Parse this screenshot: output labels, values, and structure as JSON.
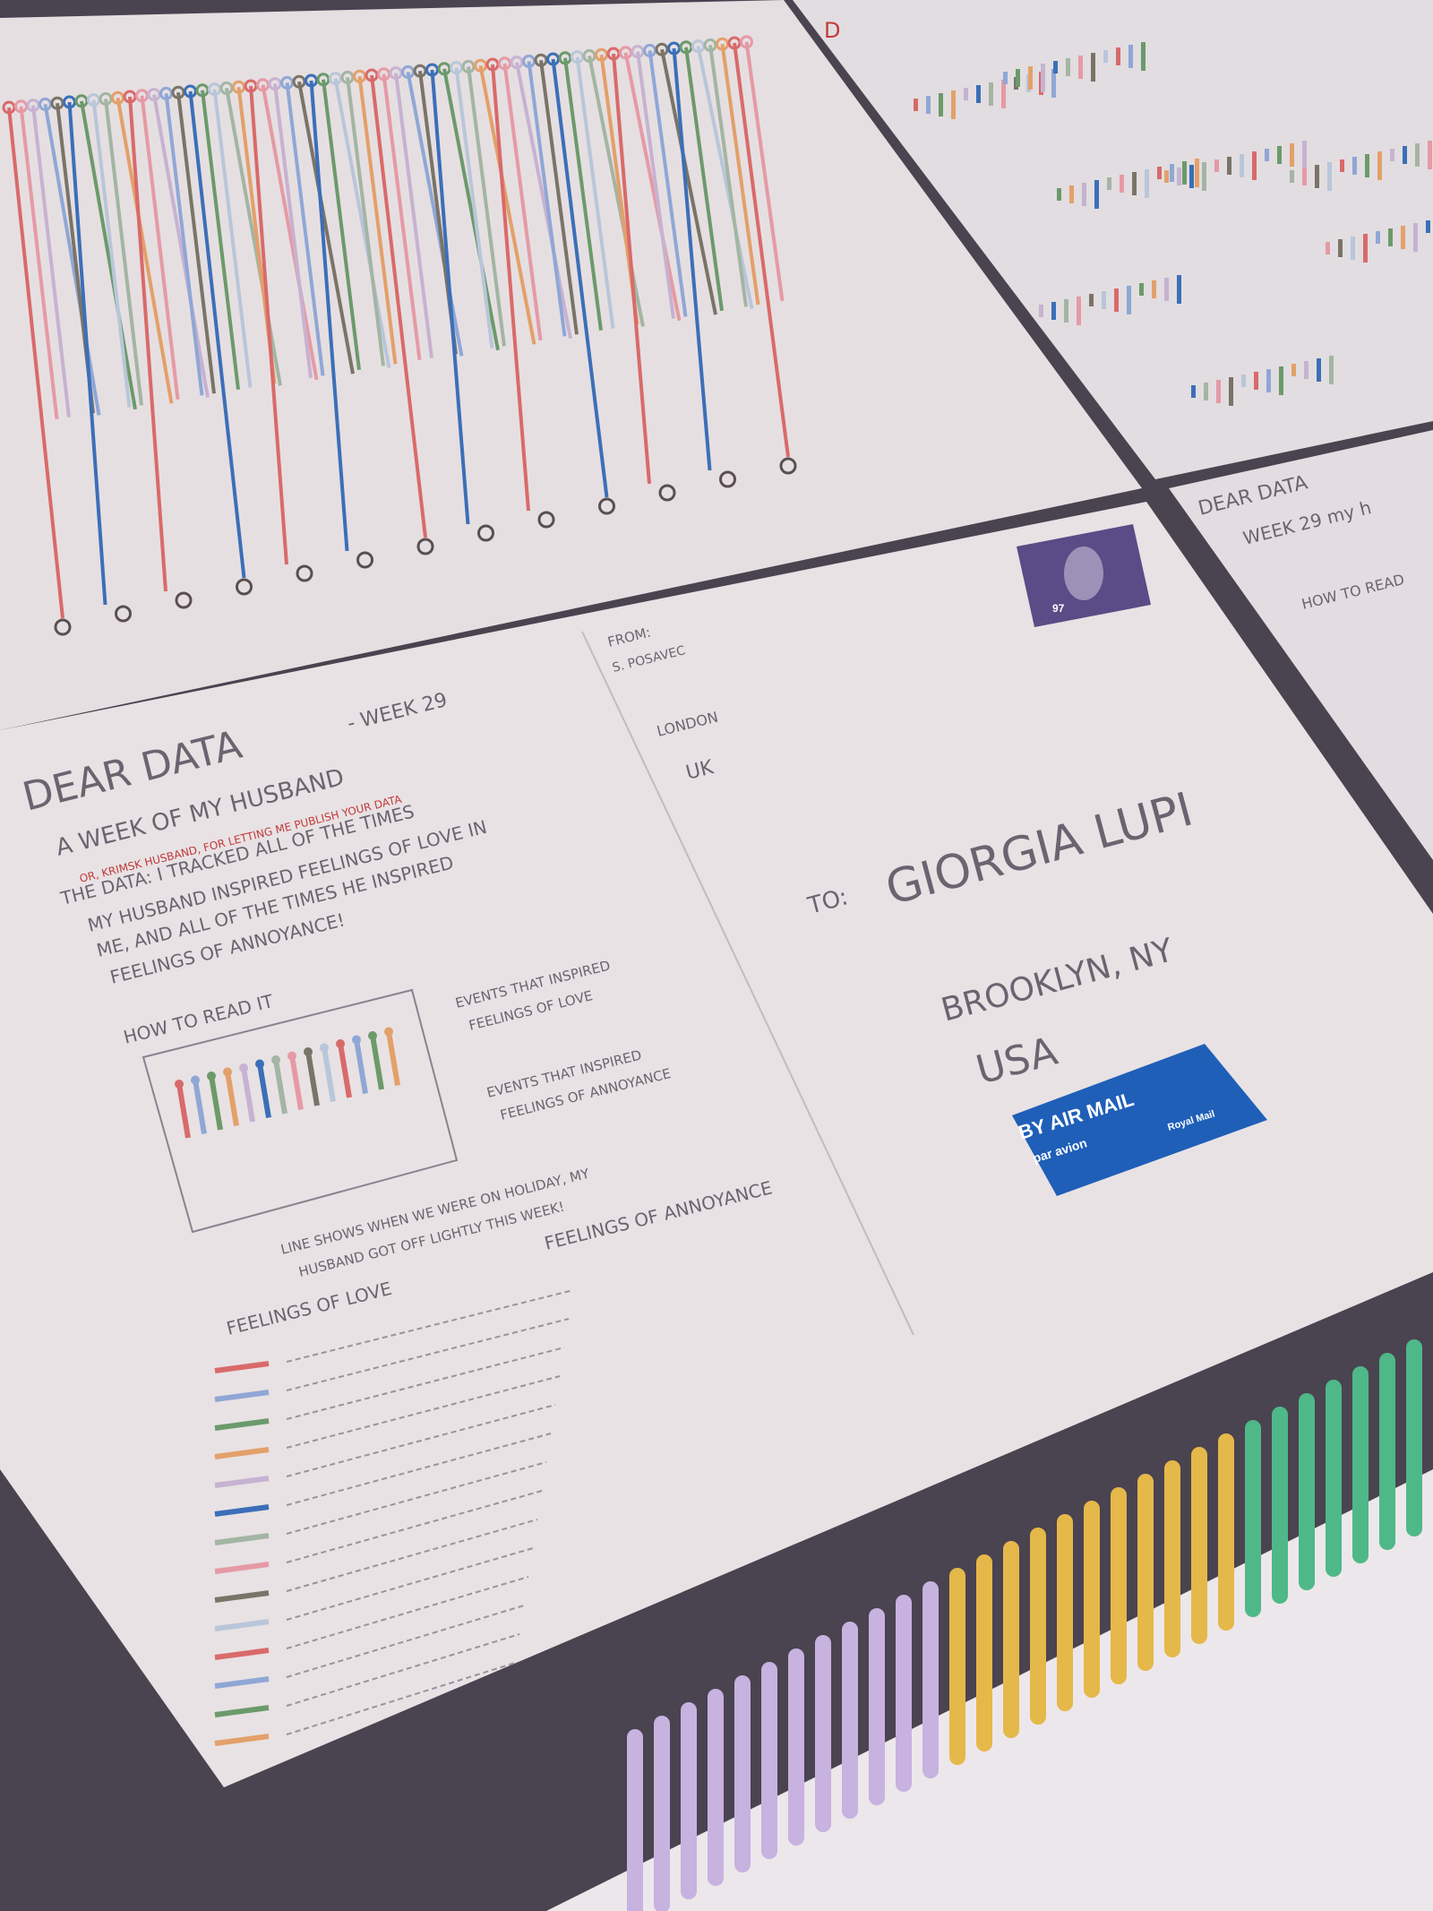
{
  "postcard_back": {
    "title": "DEAR DATA",
    "week": "- WEEK 29",
    "subtitle": "A WEEK OF MY HUSBAND",
    "red_note": "OR, KRIMSK HUSBAND, FOR LETTING ME PUBLISH YOUR DATA",
    "intro": [
      "THE DATA: I TRACKED ALL OF THE TIMES",
      "MY HUSBAND INSPIRED FEELINGS OF LOVE IN",
      "ME, AND ALL OF THE TIMES HE INSPIRED",
      "FEELINGS OF ANNOYANCE!"
    ],
    "how_to_read": "HOW TO READ IT",
    "legend_love": [
      "EVENTS THAT INSPIRED",
      "FEELINGS OF LOVE"
    ],
    "legend_annoy": [
      "EVENTS THAT INSPIRED",
      "FEELINGS OF ANNOYANCE"
    ],
    "holiday_note": [
      "LINE SHOWS WHEN WE WERE ON HOLIDAY, MY",
      "HUSBAND GOT OFF LIGHTLY THIS WEEK!"
    ],
    "feelings_of_love": "FEELINGS OF LOVE",
    "feelings_of_annoyance": "FEELINGS OF ANNOYANCE",
    "from_label": "FROM:",
    "from_name": "S. POSAVEC",
    "from_city": "LONDON",
    "from_country": "UK",
    "to_label": "TO:",
    "to_name": "GIORGIA LUPI",
    "to_city": "BROOKLYN, NY",
    "to_country": "USA",
    "airmail_line1": "BY AIR MAIL",
    "airmail_line2": "par avion",
    "airmail_line3": "Royal Mail",
    "stamp_value": "97"
  },
  "right_card": {
    "title": "DEAR DATA",
    "week": "WEEK 29 my h",
    "how_to": "HOW TO READ"
  },
  "colors": {
    "background": "#4a4350",
    "card": "#e9e3e4",
    "ink": "#6b6470",
    "red": "#c23a3a",
    "stamp": "#5b4b86",
    "airmail": "#1f5fb8"
  }
}
